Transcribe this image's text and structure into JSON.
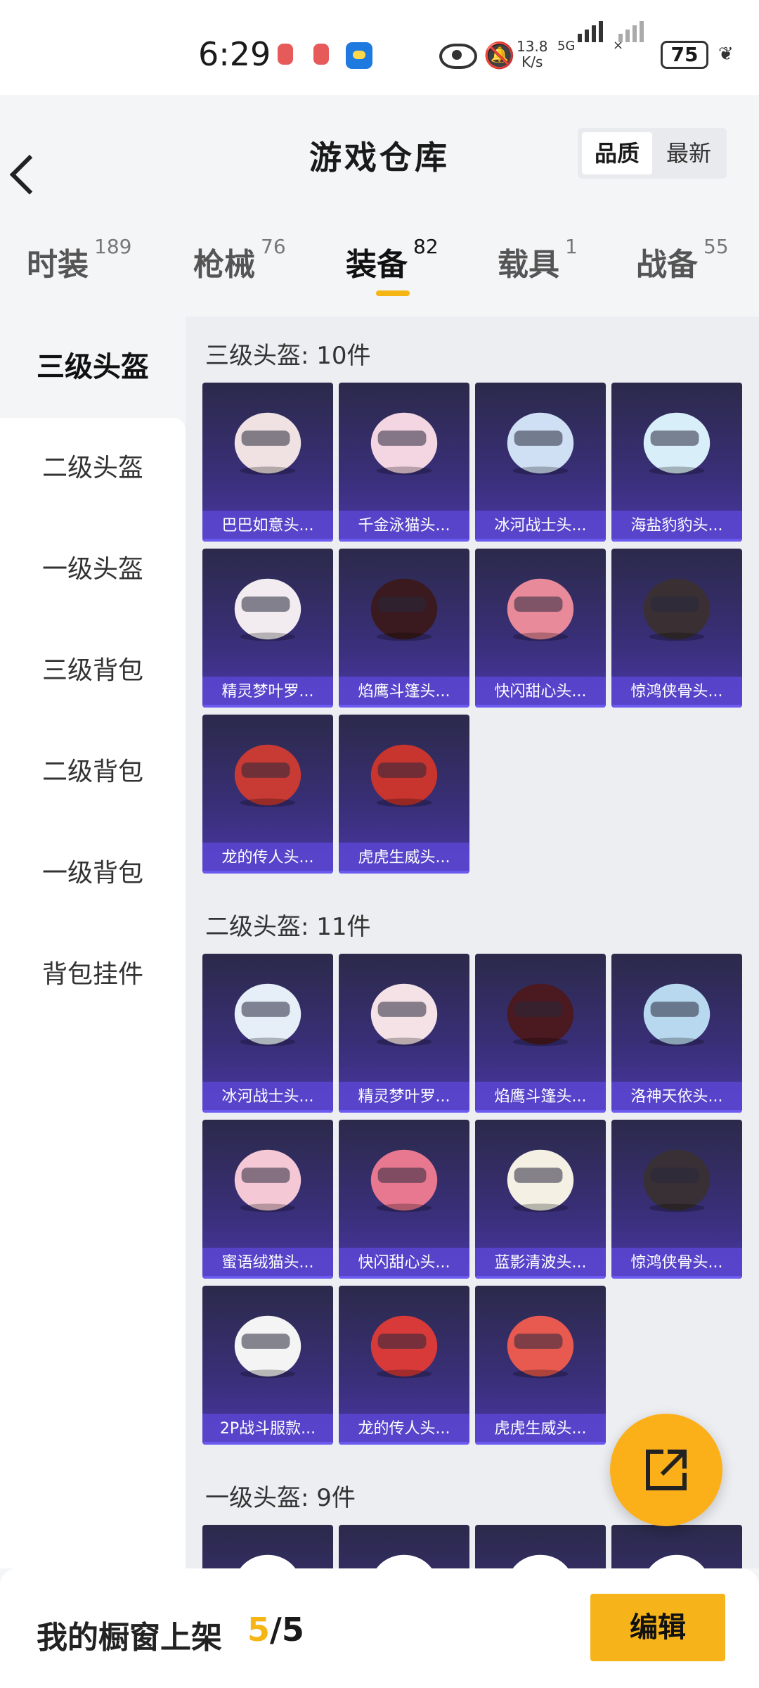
{
  "status_bar": {
    "time": "6:29",
    "speed_top": "13.8",
    "speed_bottom": "K/s",
    "network": "5G",
    "battery": "75"
  },
  "header": {
    "title": "游戏仓库",
    "sort_options": [
      "品质",
      "最新"
    ]
  },
  "tabs": [
    {
      "label": "时装",
      "count": "189"
    },
    {
      "label": "枪械",
      "count": "76"
    },
    {
      "label": "装备",
      "count": "82"
    },
    {
      "label": "载具",
      "count": "1"
    },
    {
      "label": "战备",
      "count": "55"
    }
  ],
  "sidebar": {
    "items": [
      "三级头盔",
      "二级头盔",
      "一级头盔",
      "三级背包",
      "二级背包",
      "一级背包",
      "背包挂件"
    ]
  },
  "sections": [
    {
      "title": "三级头盔: 10件",
      "items": [
        "巴巴如意头...",
        "千金泳猫头...",
        "冰河战士头...",
        "海盐豹豹头...",
        "精灵梦叶罗...",
        "焰鹰斗篷头...",
        "快闪甜心头...",
        "惊鸿侠骨头...",
        "龙的传人头...",
        "虎虎生威头..."
      ]
    },
    {
      "title": "二级头盔: 11件",
      "items": [
        "冰河战士头...",
        "精灵梦叶罗...",
        "焰鹰斗篷头...",
        "洛神天依头...",
        "蜜语绒猫头...",
        "快闪甜心头...",
        "蓝影清波头...",
        "惊鸿侠骨头...",
        "2P战斗服款...",
        "龙的传人头...",
        "虎虎生威头..."
      ]
    },
    {
      "title": "一级头盔: 9件",
      "items": [
        "",
        "",
        "",
        ""
      ]
    }
  ],
  "colors": {
    "accent": "#f5b514",
    "card_bg": "#3a2f7a",
    "card_label": "#5a46d2"
  },
  "bottom": {
    "label": "我的橱窗上架",
    "current": "5",
    "total": "/5",
    "edit": "编辑"
  },
  "icons": {
    "back": "chevron-left-icon",
    "share": "share-external-icon"
  }
}
